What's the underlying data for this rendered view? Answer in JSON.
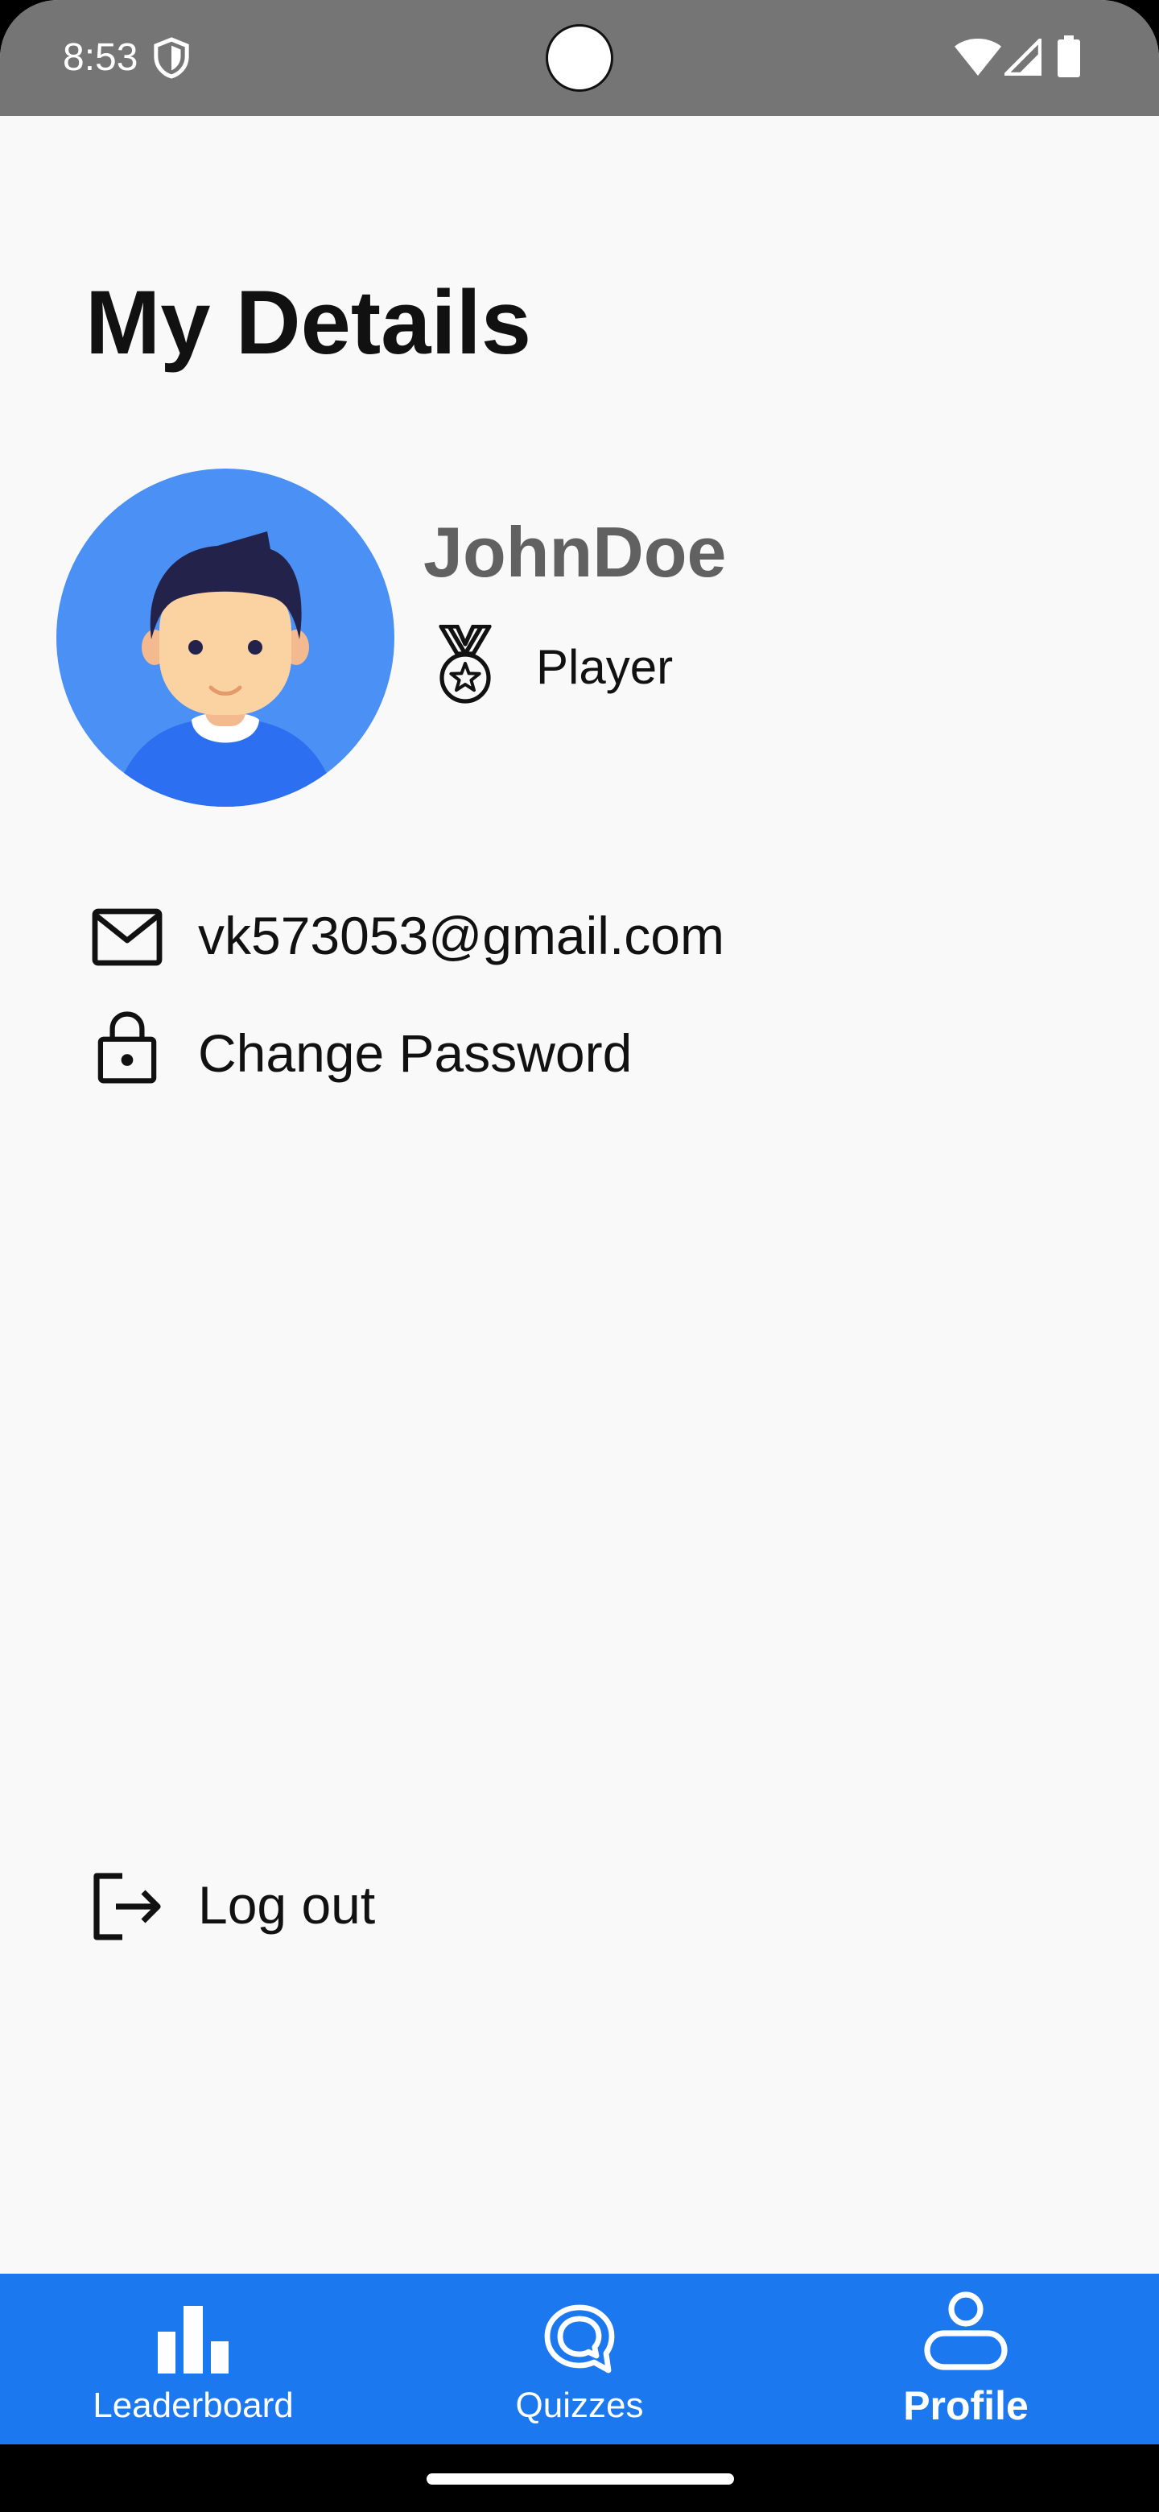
{
  "status_bar": {
    "time": "8:53",
    "icons": [
      "shield-icon",
      "wifi-icon",
      "signal-icon",
      "battery-icon"
    ]
  },
  "page": {
    "title": "My Details"
  },
  "profile": {
    "avatar": "avatar-illustration",
    "username": "JohnDoe",
    "role_icon": "medal-icon",
    "role": "Player"
  },
  "details": {
    "email": "vk573053@gmail.com",
    "email_icon": "mail-icon",
    "change_password": "Change Password",
    "change_password_icon": "lock-icon"
  },
  "logout": {
    "label": "Log out",
    "icon": "logout-icon"
  },
  "bottom_nav": {
    "items": [
      {
        "label": "Leaderboard",
        "icon": "bar-chart-icon",
        "active": false
      },
      {
        "label": "Quizzes",
        "icon": "quiz-bubble-icon",
        "active": false
      },
      {
        "label": "Profile",
        "icon": "person-icon",
        "active": true
      }
    ]
  },
  "colors": {
    "status_bar": "#757575",
    "background": "#f9f9f9",
    "nav_background": "#1c78ee",
    "username": "#616161",
    "avatar_circle": "#4a90f5"
  }
}
